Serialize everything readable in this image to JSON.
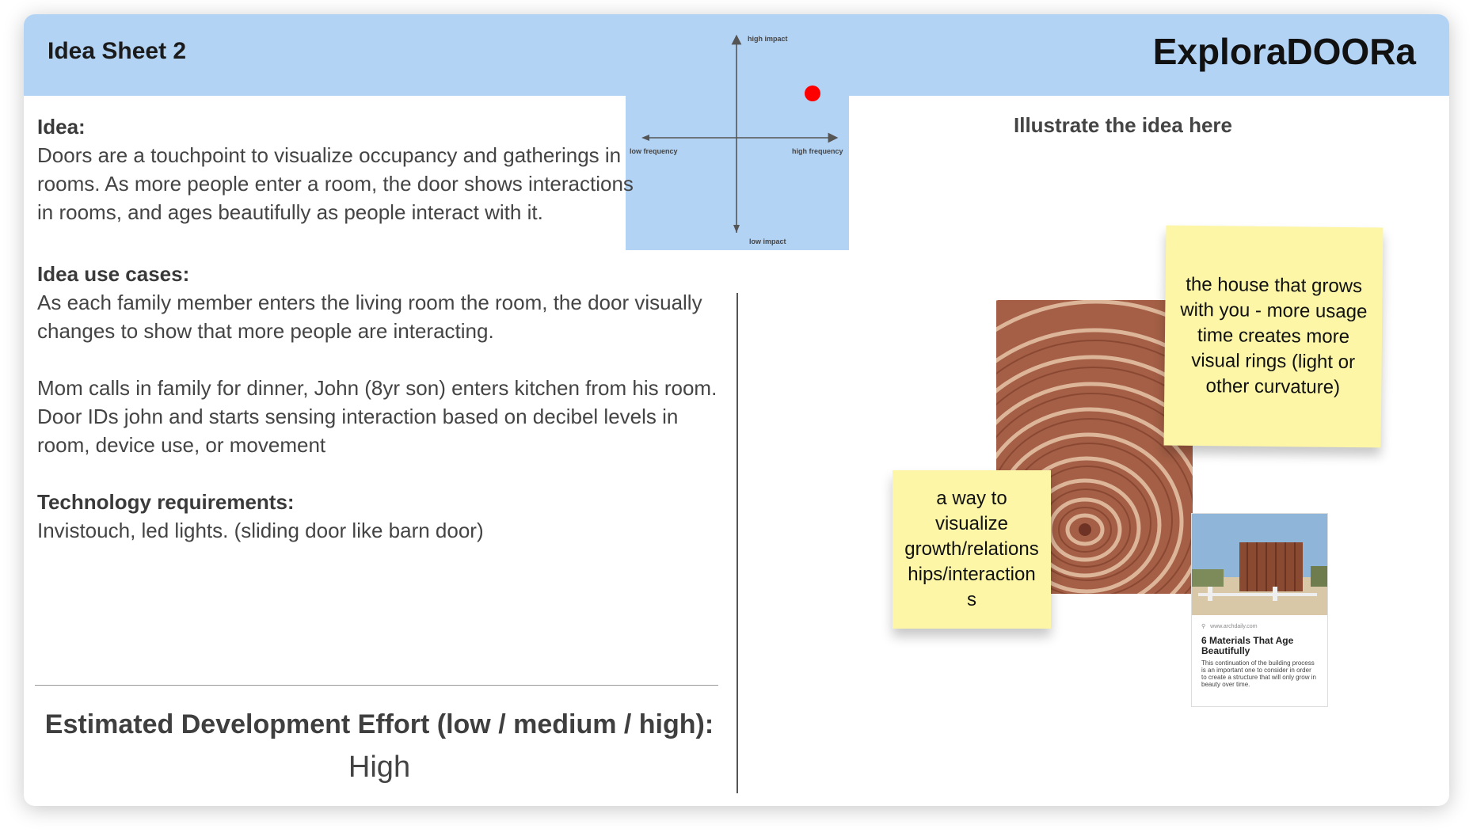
{
  "header": {
    "sheet_title": "Idea Sheet 2",
    "brand": "ExploraDOORa",
    "color": "#b3d3f5"
  },
  "matrix": {
    "top_label": "high impact",
    "bottom_label": "low impact",
    "left_label": "low frequency",
    "right_label": "high frequency",
    "marker_color": "#ff0000"
  },
  "idea": {
    "label": "Idea:",
    "text": "Doors are a touchpoint to visualize occupancy and gatherings in rooms. As more people enter a room, the door shows interactions in rooms, and ages beautifully as people interact with it."
  },
  "use_cases": {
    "label": "Idea use cases:",
    "paragraphs": [
      "As each family member enters the living room the room, the door visually changes to show that more people are interacting.",
      "Mom calls in family for dinner, John (8yr son) enters kitchen from his room. Door IDs john and starts sensing interaction based on decibel levels in room, device use, or movement"
    ]
  },
  "technology": {
    "label": "Technology requirements:",
    "text": "Invistouch, led lights. (sliding door like barn door)"
  },
  "effort": {
    "label": "Estimated Development Effort (low / medium / high):",
    "value": "High"
  },
  "illustration": {
    "heading": "Illustrate the idea here",
    "sticky_notes": [
      "the house that grows with you - more usage time creates more visual rings (light or other curvature)",
      "a way to visualize growth/relationships/interactions"
    ],
    "article": {
      "source": "www.archdaily.com",
      "title": "6 Materials That Age Beautifully",
      "description": "This continuation of the building process is an important one to consider in order to create a structure that will only grow in beauty over time."
    }
  }
}
